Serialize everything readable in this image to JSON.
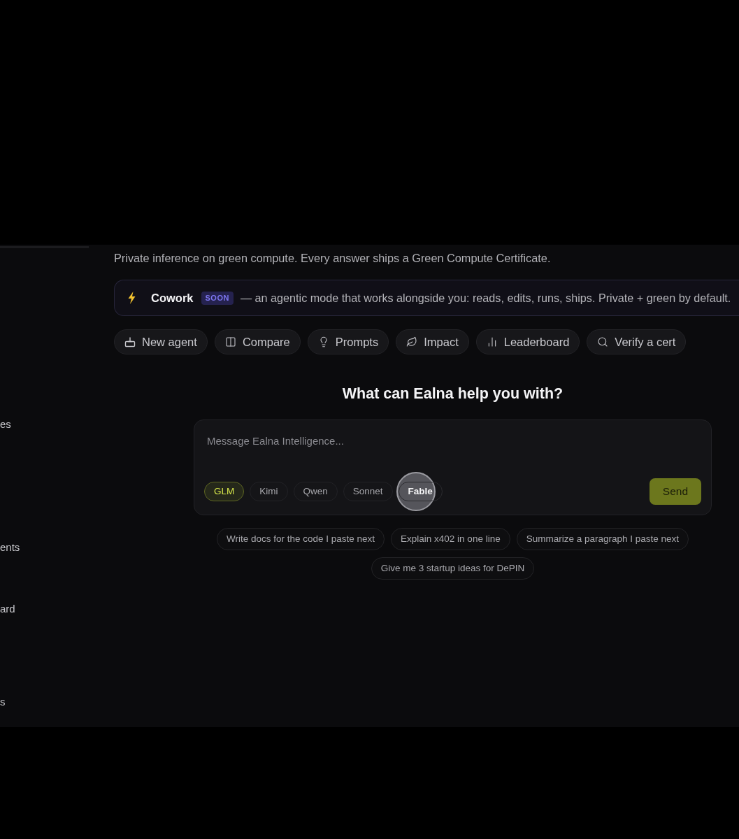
{
  "sidebar": {
    "items": [
      {
        "label": "es"
      },
      {
        "label": "ents"
      },
      {
        "label": "ard"
      },
      {
        "label": "s"
      }
    ]
  },
  "tagline": "Private inference on green compute. Every answer ships a Green Compute Certificate.",
  "banner": {
    "title": "Cowork",
    "badge": "SOON",
    "text": "— an agentic mode that works alongside you: reads, edits, runs, ships. Private + green by default."
  },
  "actions": [
    {
      "label": "New agent"
    },
    {
      "label": "Compare"
    },
    {
      "label": "Prompts"
    },
    {
      "label": "Impact"
    },
    {
      "label": "Leaderboard"
    },
    {
      "label": "Verify a cert"
    }
  ],
  "heading": "What can Ealna help you with?",
  "composer": {
    "placeholder": "Message Ealna Intelligence...",
    "models": [
      {
        "label": "GLM",
        "selected": true,
        "cursor": false
      },
      {
        "label": "Kimi",
        "selected": false,
        "cursor": false
      },
      {
        "label": "Qwen",
        "selected": false,
        "cursor": false
      },
      {
        "label": "Sonnet",
        "selected": false,
        "cursor": false
      },
      {
        "label": "Fable",
        "selected": false,
        "cursor": true
      }
    ],
    "send": "Send"
  },
  "suggestions": [
    "Write docs for the code I paste next",
    "Explain x402 in one line",
    "Summarize a paragraph I paste next",
    "Give me 3 startup ideas for DePIN"
  ]
}
